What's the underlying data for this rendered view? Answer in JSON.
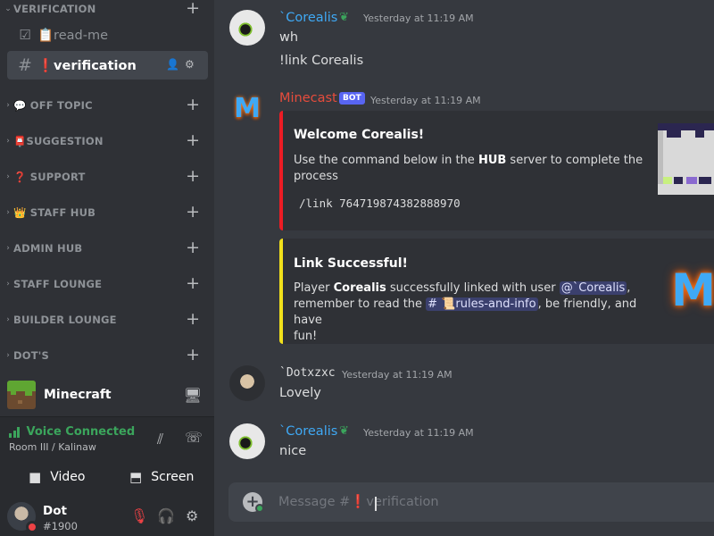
{
  "sidebar": {
    "categories": [
      {
        "name": "VERIFICATION",
        "chevron": "⌄"
      },
      {
        "name": "💬 OFF TOPIC",
        "chevron": "›"
      },
      {
        "name": "📮SUGGESTION",
        "chevron": "›"
      },
      {
        "name": "❓ SUPPORT",
        "chevron": "›"
      },
      {
        "name": "👑 STAFF HUB",
        "chevron": "›"
      },
      {
        "name": "ADMIN HUB",
        "chevron": "›"
      },
      {
        "name": "STAFF LOUNGE",
        "chevron": "›"
      },
      {
        "name": "BUILDER LOUNGE",
        "chevron": "›"
      },
      {
        "name": "DOT'S",
        "chevron": "›"
      }
    ],
    "channels": [
      {
        "name": "📋read-me",
        "icon": "rules-checkbox-icon"
      },
      {
        "name": "❗verification",
        "icon": "hash-icon"
      }
    ],
    "server": {
      "name": "Minecraft"
    },
    "voice": {
      "status": "Voice Connected",
      "room": "Room III / Kalinaw",
      "video_label": "Video",
      "screen_label": "Screen"
    },
    "user": {
      "name": "Dot",
      "tag": "#1900"
    }
  },
  "messages": [
    {
      "author": "`Corealis",
      "timestamp": "Yesterday at 11:19 AM",
      "lines": [
        "wh",
        "!link Corealis"
      ]
    },
    {
      "author": "Minecast",
      "bot_tag": "BOT",
      "timestamp": "Yesterday at 11:19 AM",
      "embeds": [
        {
          "title": "Welcome Corealis!",
          "desc_a": "Use the command below in the ",
          "desc_bold": "HUB",
          "desc_b": " server to complete the",
          "desc_c": "process",
          "code": "/link 764719874382888970",
          "color": "#ed1c24"
        },
        {
          "title": "Link Successful!",
          "p1": "Player ",
          "p1_bold": "Corealis",
          "p1_b": " successfully linked with user ",
          "mention_user": "@`Corealis",
          "p1_c": ",",
          "p2": "remember to read the ",
          "mention_channel": "# 📜rules-and-info",
          "p2_b": ", be friendly, and have",
          "p3": "fun!",
          "color": "#f1e01b"
        }
      ]
    },
    {
      "author": "`Dotxzxc",
      "timestamp": "Yesterday at 11:19 AM",
      "lines": [
        "Lovely"
      ]
    },
    {
      "author": "`Corealis",
      "timestamp": "Yesterday at 11:19 AM",
      "lines": [
        "nice"
      ]
    }
  ],
  "composer": {
    "placeholder": "Message #❗verification"
  },
  "colors": {
    "accent": "#5865f2",
    "green": "#3ba55c",
    "red": "#ed4245",
    "author_blue": "#3fa9f5",
    "author_red": "#e74c3c"
  }
}
